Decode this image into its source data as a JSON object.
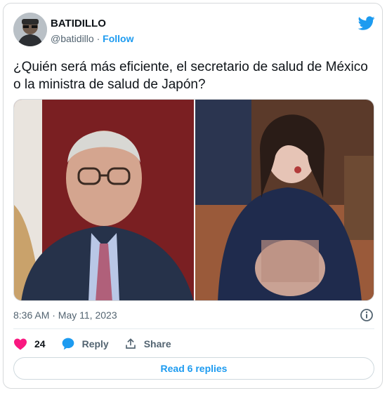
{
  "author": {
    "name": "BATIDILLO",
    "handle": "@batidillo",
    "separator": "·",
    "follow_label": "Follow"
  },
  "tweet": {
    "text": "¿Quién será más eficiente, el secretario de salud de México o la ministra de salud de Japón?",
    "timestamp": "8:36 AM · May 11, 2023"
  },
  "actions": {
    "likes_count": "24",
    "reply_label": "Reply",
    "share_label": "Share"
  },
  "read_replies_label": "Read 6 replies",
  "colors": {
    "accent": "#1d9bf0",
    "like": "#f91880",
    "muted": "#536471",
    "text": "#0f1419"
  },
  "icons": [
    "twitter-bird-icon",
    "info-icon",
    "heart-icon",
    "reply-bubble-icon",
    "share-icon"
  ]
}
